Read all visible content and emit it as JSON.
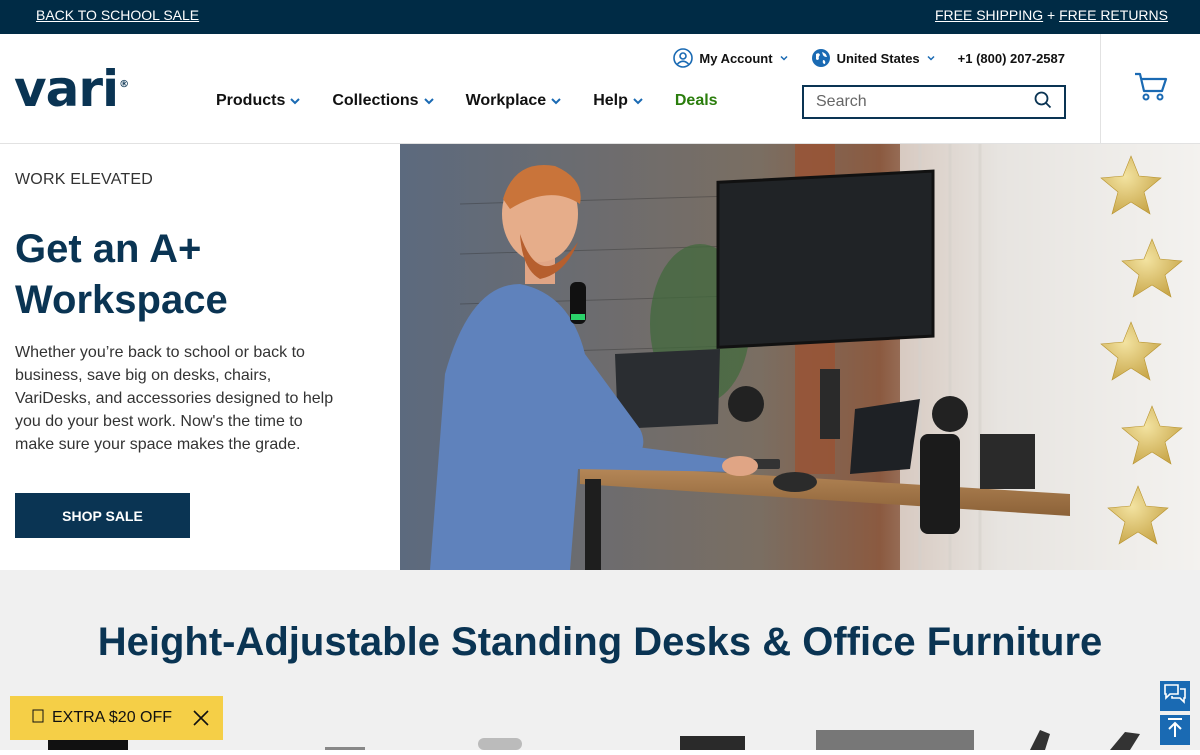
{
  "promo": {
    "left_link": "BACK TO SCHOOL SALE",
    "shipping": "FREE SHIPPING",
    "plus": " + ",
    "returns": "FREE RETURNS"
  },
  "header": {
    "logo_text": "vari",
    "logo_mark": "®",
    "account_label": "My Account",
    "region_label": "United States",
    "phone": "+1 (800) 207-2587",
    "search_placeholder": "Search",
    "nav": [
      {
        "label": "Products"
      },
      {
        "label": "Collections"
      },
      {
        "label": "Workplace"
      },
      {
        "label": "Help"
      },
      {
        "label": "Deals"
      }
    ]
  },
  "hero": {
    "eyebrow": "WORK ELEVATED",
    "title": "Get an A+ Workspace",
    "body": "Whether you’re back to school or back to business, save big on desks, chairs, VariDesks, and accessories designed to help you do your best work. Now's the time to make sure your space makes the grade.",
    "cta": "SHOP SALE"
  },
  "section": {
    "title": "Height-Adjustable Standing Desks & Office Furniture"
  },
  "floating": {
    "extra_label": "EXTRA $20 OFF",
    "extra_icon": "tag-icon"
  },
  "colors": {
    "navy": "#0a3453",
    "promo_bg": "#002b45",
    "deals_green": "#2a7d0c",
    "extra_yellow": "#f5cf47",
    "widget_blue": "#1a6ab3"
  }
}
